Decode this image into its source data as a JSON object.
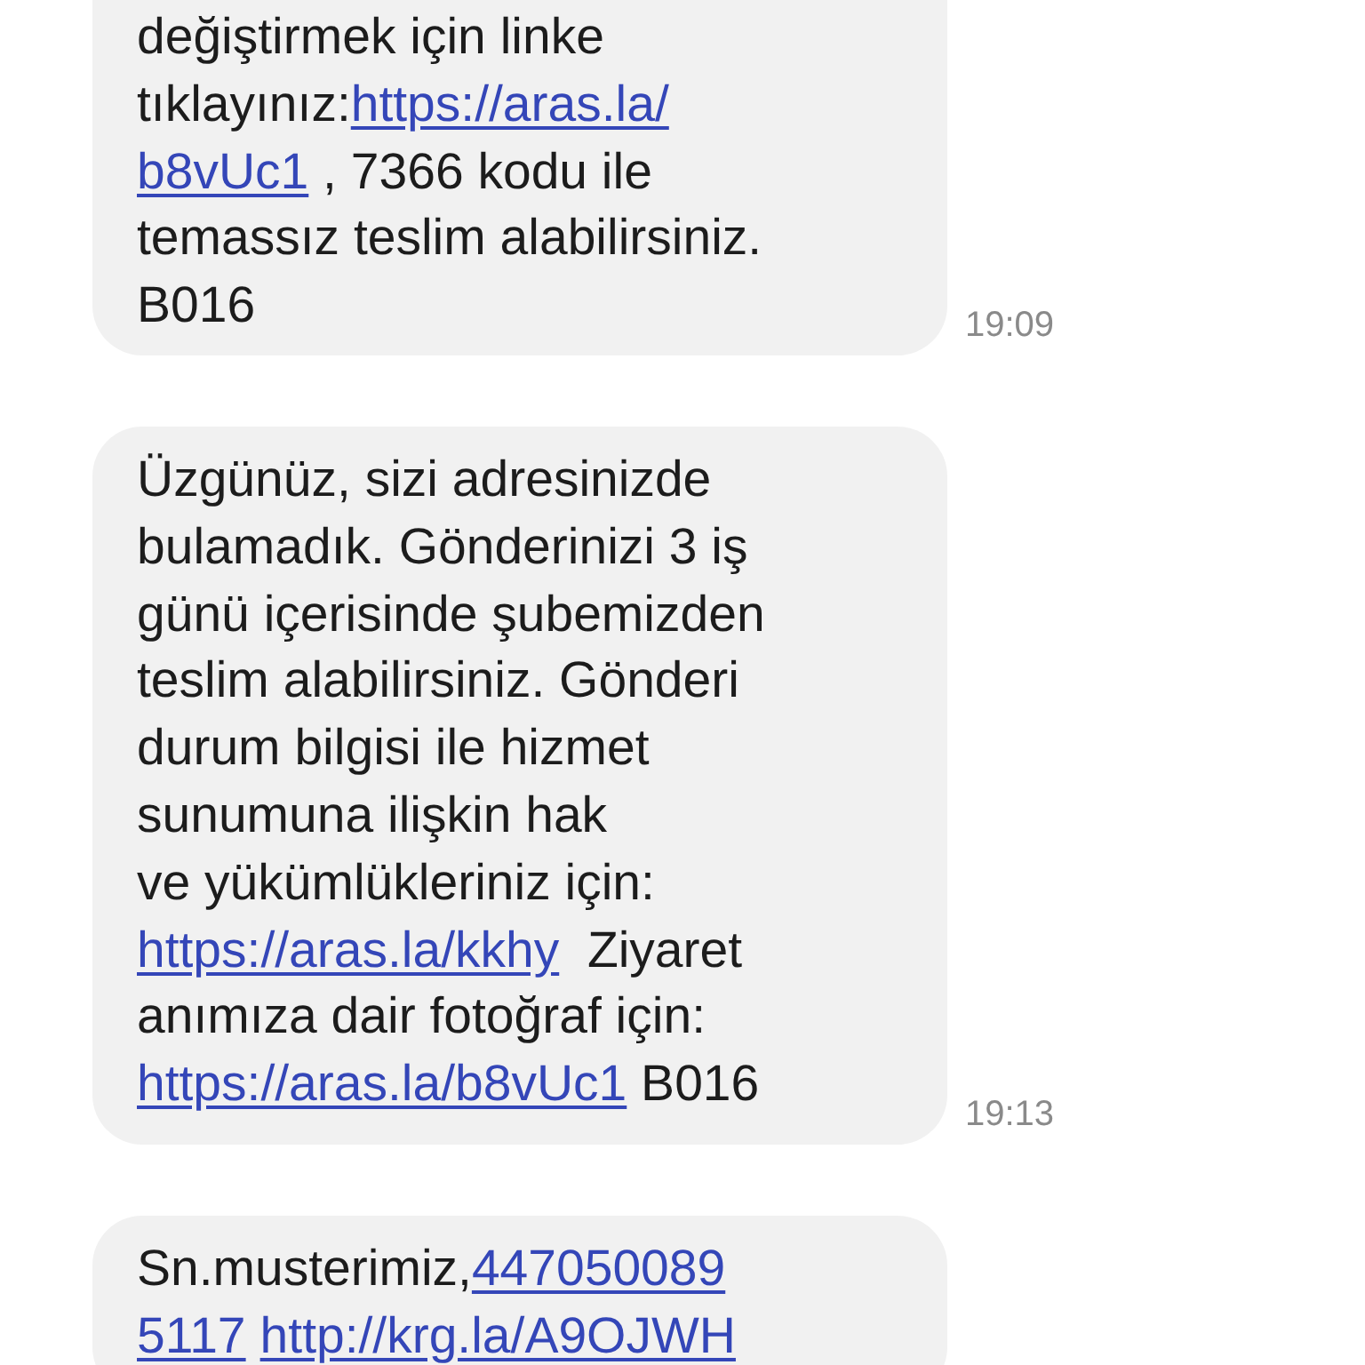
{
  "messages": [
    {
      "lines": [
        [
          {
            "kind": "text",
            "text": "değiştirmek için linke"
          }
        ],
        [
          {
            "kind": "text",
            "text": "tıklayınız:"
          },
          {
            "kind": "link",
            "text": "https://aras.la/"
          }
        ],
        [
          {
            "kind": "link",
            "text": "b8vUc1"
          },
          {
            "kind": "text",
            "text": " , 7366 kodu ile"
          }
        ],
        [
          {
            "kind": "text",
            "text": "temassız teslim alabilirsiniz."
          }
        ],
        [
          {
            "kind": "text",
            "text": "B016"
          }
        ]
      ],
      "time": "19:09"
    },
    {
      "lines": [
        [
          {
            "kind": "text",
            "text": "Üzgünüz, sizi adresinizde"
          }
        ],
        [
          {
            "kind": "text",
            "text": "bulamadık. Gönderinizi 3 iş"
          }
        ],
        [
          {
            "kind": "text",
            "text": "günü içerisinde şubemizden"
          }
        ],
        [
          {
            "kind": "text",
            "text": "teslim alabilirsiniz. Gönderi"
          }
        ],
        [
          {
            "kind": "text",
            "text": "durum bilgisi ile hizmet"
          }
        ],
        [
          {
            "kind": "text",
            "text": "sunumuna ilişkin hak"
          }
        ],
        [
          {
            "kind": "text",
            "text": "ve yükümlükleriniz için:"
          }
        ],
        [
          {
            "kind": "link",
            "text": "https://aras.la/kkhy"
          },
          {
            "kind": "text",
            "text": "  Ziyaret"
          }
        ],
        [
          {
            "kind": "text",
            "text": "anımıza dair fotoğraf için:"
          }
        ],
        [
          {
            "kind": "link",
            "text": "https://aras.la/b8vUc1"
          },
          {
            "kind": "text",
            "text": " B016"
          }
        ]
      ],
      "time": "19:13"
    },
    {
      "lines": [
        [
          {
            "kind": "text",
            "text": "Sn.musterimiz,"
          },
          {
            "kind": "link",
            "text": "447050089"
          }
        ],
        [
          {
            "kind": "link",
            "text": "5117"
          },
          {
            "kind": "link",
            "text": "http://krg.la/A9OJWH"
          }
        ]
      ]
    }
  ]
}
